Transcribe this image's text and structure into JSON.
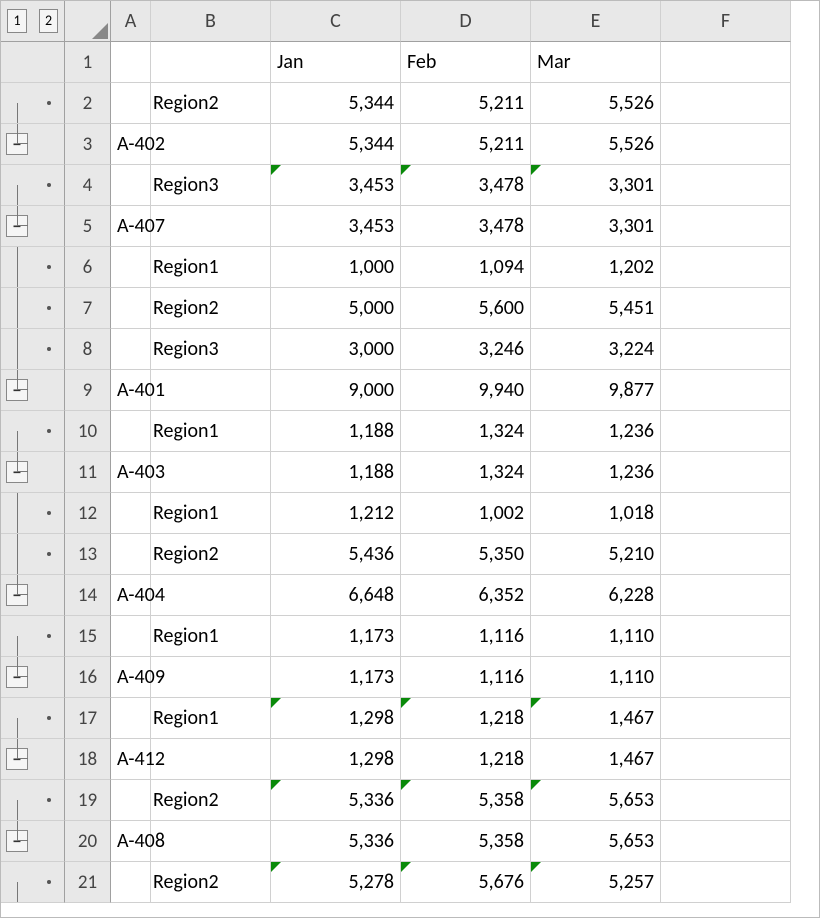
{
  "outline_levels": [
    "1",
    "2"
  ],
  "columns": [
    "A",
    "B",
    "C",
    "D",
    "E",
    "F"
  ],
  "header_row": {
    "A": "",
    "B": "",
    "C": "Jan",
    "D": "Feb",
    "E": "Mar",
    "F": ""
  },
  "rows": [
    {
      "n": 1,
      "out1": "",
      "out2": "",
      "A": "",
      "B": "",
      "C": "Jan",
      "D": "Feb",
      "E": "Mar",
      "F": "",
      "header": true
    },
    {
      "n": 2,
      "out1": "top",
      "out2": "dot",
      "A": "",
      "B": "Region2",
      "C": "5,344",
      "D": "5,211",
      "E": "5,526",
      "F": ""
    },
    {
      "n": 3,
      "out1": "minus",
      "out2": "",
      "A": "A-402",
      "B": "",
      "C": "5,344",
      "D": "5,211",
      "E": "5,526",
      "F": ""
    },
    {
      "n": 4,
      "out1": "top",
      "out2": "dot",
      "A": "",
      "B": "Region3",
      "C": "3,453",
      "D": "3,478",
      "E": "3,301",
      "F": "",
      "flag": true
    },
    {
      "n": 5,
      "out1": "minus",
      "out2": "",
      "A": "A-407",
      "B": "",
      "C": "3,453",
      "D": "3,478",
      "E": "3,301",
      "F": ""
    },
    {
      "n": 6,
      "out1": "mid",
      "out2": "dot",
      "A": "",
      "B": "Region1",
      "C": "1,000",
      "D": "1,094",
      "E": "1,202",
      "F": ""
    },
    {
      "n": 7,
      "out1": "mid",
      "out2": "dot",
      "A": "",
      "B": "Region2",
      "C": "5,000",
      "D": "5,600",
      "E": "5,451",
      "F": ""
    },
    {
      "n": 8,
      "out1": "mid",
      "out2": "dot",
      "A": "",
      "B": "Region3",
      "C": "3,000",
      "D": "3,246",
      "E": "3,224",
      "F": ""
    },
    {
      "n": 9,
      "out1": "minus",
      "out2": "",
      "A": "A-401",
      "B": "",
      "C": "9,000",
      "D": "9,940",
      "E": "9,877",
      "F": ""
    },
    {
      "n": 10,
      "out1": "top",
      "out2": "dot",
      "A": "",
      "B": "Region1",
      "C": "1,188",
      "D": "1,324",
      "E": "1,236",
      "F": ""
    },
    {
      "n": 11,
      "out1": "minus",
      "out2": "",
      "A": "A-403",
      "B": "",
      "C": "1,188",
      "D": "1,324",
      "E": "1,236",
      "F": ""
    },
    {
      "n": 12,
      "out1": "mid",
      "out2": "dot",
      "A": "",
      "B": "Region1",
      "C": "1,212",
      "D": "1,002",
      "E": "1,018",
      "F": ""
    },
    {
      "n": 13,
      "out1": "mid",
      "out2": "dot",
      "A": "",
      "B": "Region2",
      "C": "5,436",
      "D": "5,350",
      "E": "5,210",
      "F": ""
    },
    {
      "n": 14,
      "out1": "minus",
      "out2": "",
      "A": "A-404",
      "B": "",
      "C": "6,648",
      "D": "6,352",
      "E": "6,228",
      "F": ""
    },
    {
      "n": 15,
      "out1": "top",
      "out2": "dot",
      "A": "",
      "B": "Region1",
      "C": "1,173",
      "D": "1,116",
      "E": "1,110",
      "F": ""
    },
    {
      "n": 16,
      "out1": "minus",
      "out2": "",
      "A": "A-409",
      "B": "",
      "C": "1,173",
      "D": "1,116",
      "E": "1,110",
      "F": ""
    },
    {
      "n": 17,
      "out1": "top",
      "out2": "dot",
      "A": "",
      "B": "Region1",
      "C": "1,298",
      "D": "1,218",
      "E": "1,467",
      "F": "",
      "flag": true
    },
    {
      "n": 18,
      "out1": "minus",
      "out2": "",
      "A": "A-412",
      "B": "",
      "C": "1,298",
      "D": "1,218",
      "E": "1,467",
      "F": ""
    },
    {
      "n": 19,
      "out1": "top",
      "out2": "dot",
      "A": "",
      "B": "Region2",
      "C": "5,336",
      "D": "5,358",
      "E": "5,653",
      "F": "",
      "flag": true
    },
    {
      "n": 20,
      "out1": "minus",
      "out2": "",
      "A": "A-408",
      "B": "",
      "C": "5,336",
      "D": "5,358",
      "E": "5,653",
      "F": ""
    },
    {
      "n": 21,
      "out1": "top",
      "out2": "dot",
      "A": "",
      "B": "Region2",
      "C": "5,278",
      "D": "5,676",
      "E": "5,257",
      "F": "",
      "flag": true
    }
  ]
}
